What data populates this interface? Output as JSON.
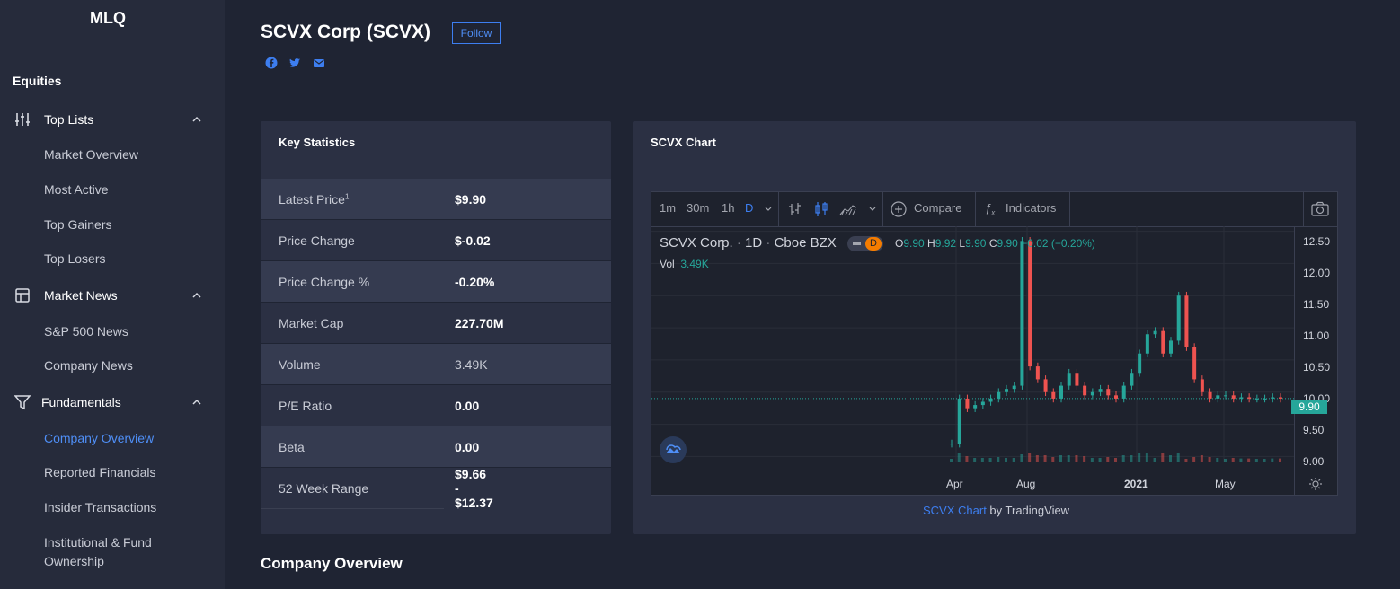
{
  "brand": "MLQ",
  "sidebar": {
    "section_title": "Equities",
    "groups": [
      {
        "label": "Top Lists",
        "items": [
          "Market Overview",
          "Most Active",
          "Top Gainers",
          "Top Losers"
        ]
      },
      {
        "label": "Market News",
        "items": [
          "S&P 500 News",
          "Company News"
        ]
      },
      {
        "label": "Fundamentals",
        "items": [
          "Company Overview",
          "Reported Financials",
          "Insider Transactions",
          "Institutional & Fund",
          "Ownership"
        ]
      }
    ],
    "active_item": "Company Overview",
    "accent": "#4f8ff7"
  },
  "header": {
    "title": "SCVX Corp (SCVX)",
    "follow_label": "Follow",
    "social_icons": [
      "facebook-icon",
      "twitter-icon",
      "email-icon"
    ]
  },
  "key_stats": {
    "title": "Key Statistics",
    "rows": [
      {
        "label": "Latest Price",
        "sup": "1",
        "value": "$9.90"
      },
      {
        "label": "Price Change",
        "value": "$-0.02"
      },
      {
        "label": "Price Change %",
        "value": "-0.20%"
      },
      {
        "label": "Market Cap",
        "value": "227.70M"
      },
      {
        "label": "Volume",
        "value": "3.49K"
      },
      {
        "label": "P/E Ratio",
        "value": "0.00"
      },
      {
        "label": "Beta",
        "value": "0.00"
      },
      {
        "label": "52 Week Range",
        "value": "$9.66 - $12.37"
      }
    ]
  },
  "chart_card": {
    "title": "SCVX Chart",
    "toolbar": {
      "intervals": [
        "1m",
        "30m",
        "1h",
        "D"
      ],
      "active_interval": "D",
      "compare_label": "Compare",
      "indicators_label": "Indicators"
    },
    "legend": {
      "symbol": "SCVX Corp.",
      "interval": "1D",
      "exchange": "Cboe BZX",
      "badge": "D",
      "o_label": "O",
      "o": "9.90",
      "h_label": "H",
      "h": "9.92",
      "l_label": "L",
      "l": "9.90",
      "c_label": "C",
      "c": "9.90",
      "change": "−0.02 (−0.20%)",
      "vol_label": "Vol",
      "vol": "3.49K"
    },
    "price_tag": "9.90",
    "attribution_link": "SCVX Chart",
    "attribution_rest": " by TradingView",
    "up_color": "#26a69a",
    "down_color": "#ef5350"
  },
  "chart_data": {
    "type": "line",
    "title": "",
    "y_ticks": [
      "12.50",
      "12.00",
      "11.50",
      "11.00",
      "10.50",
      "10.00",
      "9.50",
      "9.00"
    ],
    "ylim": [
      8.95,
      12.55
    ],
    "x_ticks": [
      "Apr",
      "Aug",
      "2021",
      "May"
    ],
    "series": [
      {
        "values": [
          9.2,
          9.9,
          9.75,
          9.8,
          9.85,
          9.9,
          10.0,
          10.05,
          10.1,
          12.35,
          10.4,
          10.2,
          10.0,
          9.9,
          10.1,
          10.3,
          10.1,
          9.95,
          10.0,
          10.05,
          9.95,
          9.9,
          10.1,
          10.3,
          10.6,
          10.9,
          10.95,
          10.6,
          10.8,
          11.5,
          10.7,
          10.2,
          10.0,
          9.9,
          9.95,
          9.95,
          9.9,
          9.92,
          9.9,
          9.9,
          9.9,
          9.92,
          9.9
        ]
      }
    ],
    "grid": true
  },
  "company_overview_title": "Company Overview"
}
